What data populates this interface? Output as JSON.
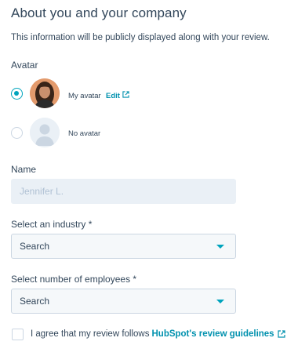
{
  "header": {
    "title": "About you and your company",
    "subtitle": "This information will be publicly displayed along with your review."
  },
  "avatar_section": {
    "label": "Avatar",
    "options": [
      {
        "label": "My avatar",
        "selected": true,
        "edit_label": "Edit"
      },
      {
        "label": "No avatar",
        "selected": false
      }
    ]
  },
  "name_field": {
    "label": "Name",
    "value": "Jennifer L."
  },
  "industry_field": {
    "label": "Select an industry *",
    "value": "Search"
  },
  "employees_field": {
    "label": "Select number of employees *",
    "value": "Search"
  },
  "agreement": {
    "checked": false,
    "text": "I agree that my review follows",
    "link_text": "HubSpot's review guidelines"
  },
  "colors": {
    "accent": "#00a4bd",
    "link": "#0091ae",
    "text": "#33475b",
    "border": "#cbd6e2"
  }
}
